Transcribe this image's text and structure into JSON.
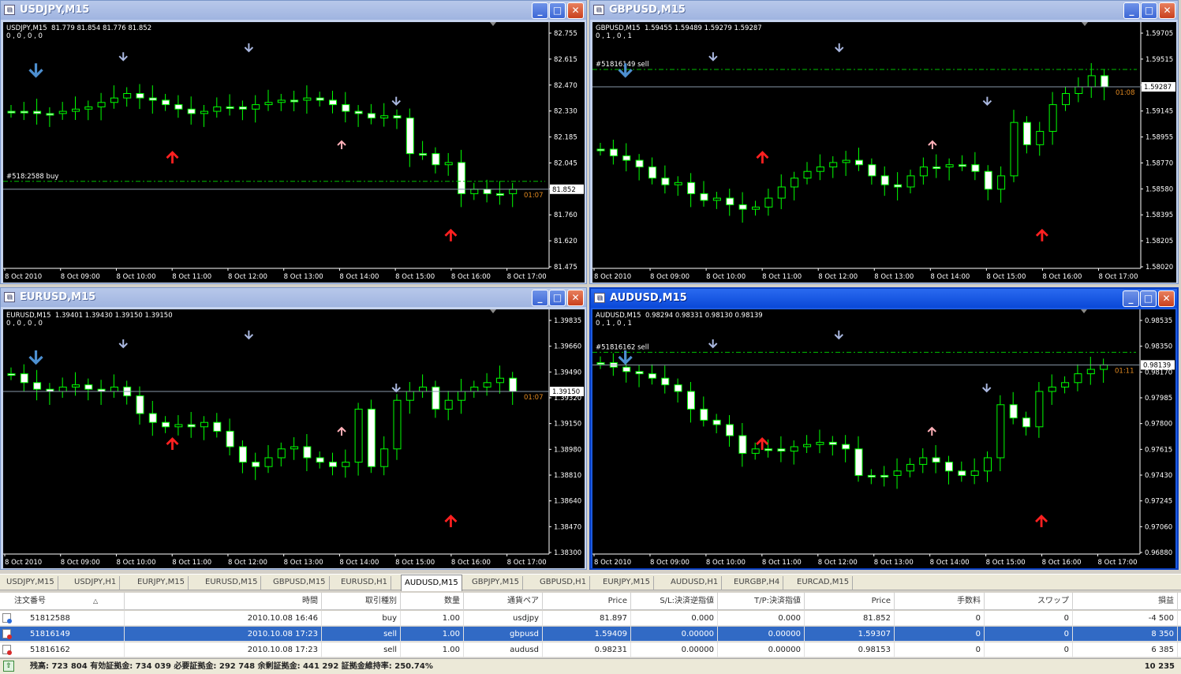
{
  "windows": [
    {
      "id": "usdjpy",
      "title": "USDJPY,M15",
      "active": false,
      "header": "USDJPY,M15  81.779 81.854 81.776 81.852",
      "sub": "0 , 0 , 0 , 0",
      "prices": [
        "82.755",
        "82.615",
        "82.470",
        "82.330",
        "82.185",
        "82.045",
        "81.905",
        "81.760",
        "81.620",
        "81.475"
      ],
      "current": "81.852",
      "order": "#518:2588 buy",
      "timer": "01:07",
      "times": [
        "8 Oct 2010",
        "8 Oct 09:00",
        "8 Oct 10:00",
        "8 Oct 11:00",
        "8 Oct 12:00",
        "8 Oct 13:00",
        "8 Oct 14:00",
        "8 Oct 15:00",
        "8 Oct 16:00",
        "8 Oct 17:00"
      ]
    },
    {
      "id": "gbpusd",
      "title": "GBPUSD,M15",
      "active": false,
      "header": "GBPUSD,M15  1.59455 1.59489 1.59279 1.59287",
      "sub": "0 , 1 , 0 , 1",
      "prices": [
        "1.59705",
        "1.59515",
        "1.59330",
        "1.59145",
        "1.58955",
        "1.58770",
        "1.58580",
        "1.58395",
        "1.58205",
        "1.58020"
      ],
      "current": "1.59287",
      "order": "#51816149 sell",
      "timer": "01:08",
      "times": [
        "8 Oct 2010",
        "8 Oct 09:00",
        "8 Oct 10:00",
        "8 Oct 11:00",
        "8 Oct 12:00",
        "8 Oct 13:00",
        "8 Oct 14:00",
        "8 Oct 15:00",
        "8 Oct 16:00",
        "8 Oct 17:00"
      ]
    },
    {
      "id": "eurusd",
      "title": "EURUSD,M15",
      "active": false,
      "header": "EURUSD,M15  1.39401 1.39430 1.39150 1.39150",
      "sub": "0 , 0 , 0 , 0",
      "prices": [
        "1.39835",
        "1.39660",
        "1.39490",
        "1.39320",
        "1.39150",
        "1.38980",
        "1.38810",
        "1.38640",
        "1.38470",
        "1.38300"
      ],
      "current": "1.39150",
      "order": "",
      "timer": "01:07",
      "times": [
        "8 Oct 2010",
        "8 Oct 09:00",
        "8 Oct 10:00",
        "8 Oct 11:00",
        "8 Oct 12:00",
        "8 Oct 13:00",
        "8 Oct 14:00",
        "8 Oct 15:00",
        "8 Oct 16:00",
        "8 Oct 17:00"
      ]
    },
    {
      "id": "audusd",
      "title": "AUDUSD,M15",
      "active": true,
      "header": "AUDUSD,M15  0.98294 0.98331 0.98130 0.98139",
      "sub": "0 , 1 , 0 , 1",
      "prices": [
        "0.98535",
        "0.98350",
        "0.98170",
        "0.97985",
        "0.97800",
        "0.97615",
        "0.97430",
        "0.97245",
        "0.97060",
        "0.96880"
      ],
      "current": "0.98139",
      "order": "#51816162 sell",
      "timer": "01:11",
      "times": [
        "8 Oct 2010",
        "8 Oct 09:00",
        "8 Oct 10:00",
        "8 Oct 11:00",
        "8 Oct 12:00",
        "8 Oct 13:00",
        "8 Oct 14:00",
        "8 Oct 15:00",
        "8 Oct 16:00",
        "8 Oct 17:00"
      ]
    }
  ],
  "tabs": [
    "USDJPY,M15",
    "USDJPY,H1",
    "EURJPY,M15",
    "EURUSD,M15",
    "GBPUSD,M15",
    "EURUSD,H1",
    "AUDUSD,M15",
    "GBPJPY,M15",
    "GBPUSD,H1",
    "EURJPY,M15",
    "AUDUSD,H1",
    "EURGBP,H4",
    "EURCAD,M15"
  ],
  "selected_tab": "AUDUSD,M15",
  "columns": [
    "注文番号",
    "時間",
    "取引種別",
    "数量",
    "通貨ペア",
    "Price",
    "S/L:決済逆指値",
    "T/P:決済指値",
    "Price",
    "手数料",
    "スワップ",
    "損益"
  ],
  "sort_mark": "△",
  "orders": [
    [
      "51812588",
      "2010.10.08 16:46",
      "buy",
      "1.00",
      "usdjpy",
      "81.897",
      "0.000",
      "0.000",
      "81.852",
      "0",
      "0",
      "-4 500"
    ],
    [
      "51816149",
      "2010.10.08 17:23",
      "sell",
      "1.00",
      "gbpusd",
      "1.59409",
      "0.00000",
      "0.00000",
      "1.59307",
      "0",
      "0",
      "8 350"
    ],
    [
      "51816162",
      "2010.10.08 17:23",
      "sell",
      "1.00",
      "audusd",
      "0.98231",
      "0.00000",
      "0.00000",
      "0.98153",
      "0",
      "0",
      "6 385"
    ]
  ],
  "selected_order": "51816149",
  "status_text": "残高: 723 804  有効証拠金: 734 039  必要証拠金: 292 748  余剰証拠金: 441 292  証拠金維持率: 250.74%",
  "status_total": "10 235",
  "colors": {
    "bull": "#00ff00",
    "bear": "#ffffff",
    "arrow_down": "#aab8e0",
    "arrow_big": "#4d8fd0",
    "arrow_up_red": "#ff2020",
    "arrow_up_pink": "#ffb0b8",
    "order_line": "#00c000",
    "price_line": "#8898a8"
  }
}
